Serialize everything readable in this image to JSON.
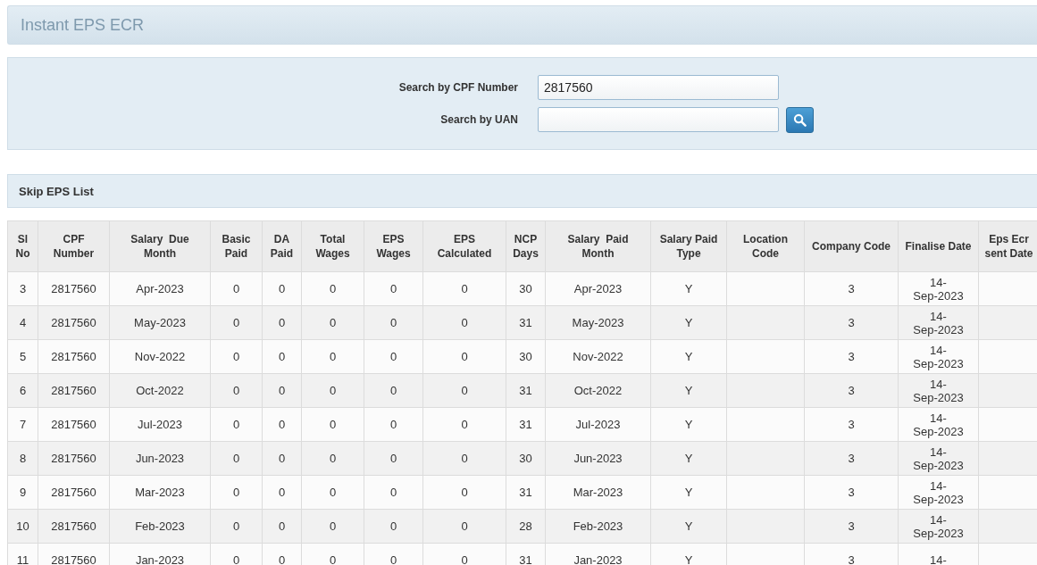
{
  "page_title": "Instant EPS ECR",
  "search": {
    "fields": [
      {
        "label": "Search by CPF Number",
        "value": "2817560"
      },
      {
        "label": "Search by UAN"
      }
    ]
  },
  "list": {
    "title": "Skip EPS List",
    "columns": [
      "Sl No",
      "CPF Number",
      "Salary  Due Month",
      "Basic Paid",
      "DA Paid",
      "Total Wages",
      "EPS Wages",
      "EPS Calculated",
      "NCP Days",
      "Salary  Paid Month",
      "Salary Paid Type",
      "Location Code",
      "Company Code",
      "Finalise Date",
      "Eps Ecr sent Date"
    ],
    "rows": [
      [
        "3",
        "2817560",
        "Apr-2023",
        "0",
        "0",
        "0",
        "0",
        "0",
        "30",
        "Apr-2023",
        "Y",
        null,
        "3",
        "14-Sep-2023",
        null
      ],
      [
        "4",
        "2817560",
        "May-2023",
        "0",
        "0",
        "0",
        "0",
        "0",
        "31",
        "May-2023",
        "Y",
        null,
        "3",
        "14-Sep-2023",
        null
      ],
      [
        "5",
        "2817560",
        "Nov-2022",
        "0",
        "0",
        "0",
        "0",
        "0",
        "30",
        "Nov-2022",
        "Y",
        null,
        "3",
        "14-Sep-2023",
        null
      ],
      [
        "6",
        "2817560",
        "Oct-2022",
        "0",
        "0",
        "0",
        "0",
        "0",
        "31",
        "Oct-2022",
        "Y",
        null,
        "3",
        "14-Sep-2023",
        null
      ],
      [
        "7",
        "2817560",
        "Jul-2023",
        "0",
        "0",
        "0",
        "0",
        "0",
        "31",
        "Jul-2023",
        "Y",
        null,
        "3",
        "14-Sep-2023",
        null
      ],
      [
        "8",
        "2817560",
        "Jun-2023",
        "0",
        "0",
        "0",
        "0",
        "0",
        "30",
        "Jun-2023",
        "Y",
        null,
        "3",
        "14-Sep-2023",
        null
      ],
      [
        "9",
        "2817560",
        "Mar-2023",
        "0",
        "0",
        "0",
        "0",
        "0",
        "31",
        "Mar-2023",
        "Y",
        null,
        "3",
        "14-Sep-2023",
        null
      ],
      [
        "10",
        "2817560",
        "Feb-2023",
        "0",
        "0",
        "0",
        "0",
        "0",
        "28",
        "Feb-2023",
        "Y",
        null,
        "3",
        "14-Sep-2023",
        null
      ],
      [
        "11",
        "2817560",
        "Jan-2023",
        "0",
        "0",
        "0",
        "0",
        "0",
        "31",
        "Jan-2023",
        "Y",
        null,
        "3",
        "14-",
        null
      ]
    ]
  }
}
